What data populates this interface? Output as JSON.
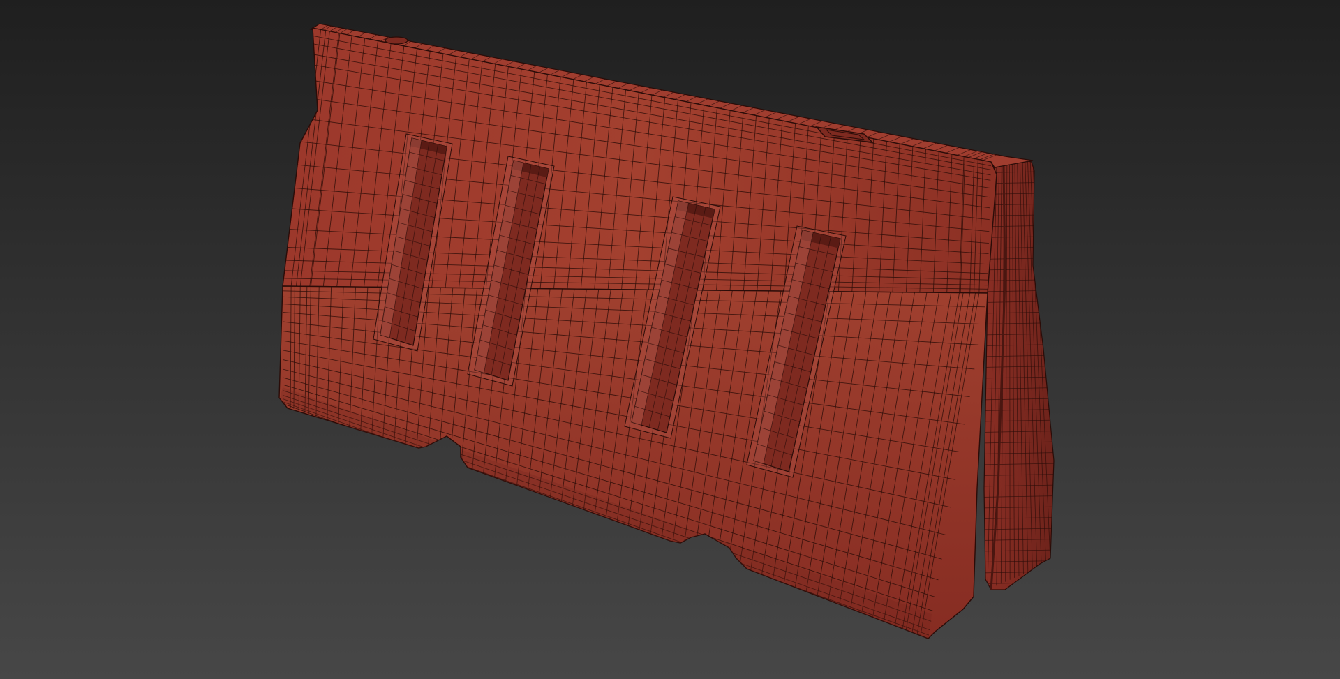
{
  "viewport": {
    "background_top": "#1f1f1f",
    "background_bottom": "#474747"
  },
  "model": {
    "name": "barrier",
    "colors": {
      "front_base": "#963428",
      "front_light": "#a84438",
      "front_dark": "#7e2a20",
      "side_face": "#7a2820",
      "top_face": "#9c3a2d",
      "wire": "#2a0c08",
      "slot_shadow": "#5a1b14",
      "slot_highlight": "#b5574a"
    }
  }
}
